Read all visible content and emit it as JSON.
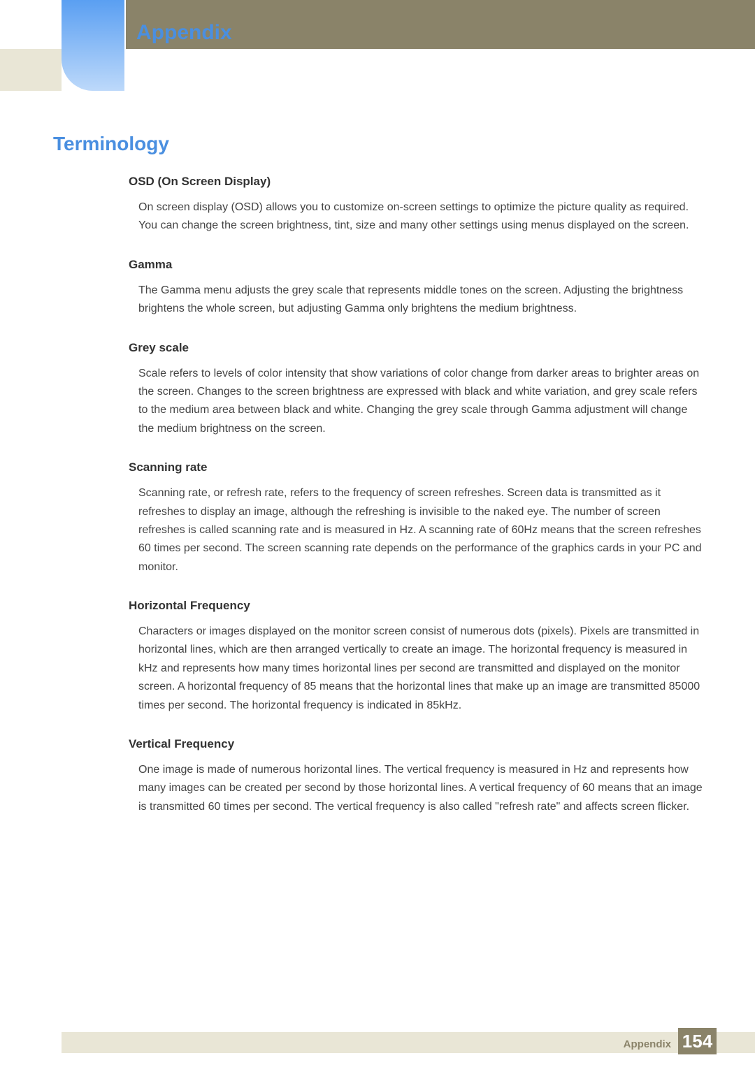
{
  "header": {
    "chapter": "Appendix",
    "section": "Terminology"
  },
  "terms": [
    {
      "title": "OSD (On Screen Display)",
      "body": "On screen display (OSD) allows you to customize on-screen settings to optimize the picture quality as required. You can change the screen brightness, tint, size and many other settings using menus displayed on the screen."
    },
    {
      "title": "Gamma",
      "body": "The Gamma menu adjusts the grey scale that represents middle tones on the screen. Adjusting the brightness brightens the whole screen, but adjusting Gamma only brightens the medium brightness."
    },
    {
      "title": "Grey scale",
      "body": "Scale refers to levels of color intensity that show variations of color change from darker areas to brighter areas on the screen. Changes to the screen brightness are expressed with black and white variation, and grey scale refers to the medium area between black and white. Changing the grey scale through Gamma adjustment will change the medium brightness on the screen."
    },
    {
      "title": "Scanning rate",
      "body": "Scanning rate, or refresh rate, refers to the frequency of screen refreshes. Screen data is transmitted as it refreshes to display an image, although the refreshing is invisible to the naked eye. The number of screen refreshes is called scanning rate and is measured in Hz. A scanning rate of 60Hz means that the screen refreshes 60 times per second. The screen scanning rate depends on the performance of the graphics cards in your PC and monitor."
    },
    {
      "title": "Horizontal Frequency",
      "body": "Characters or images displayed on the monitor screen consist of numerous dots (pixels). Pixels are transmitted in horizontal lines, which are then arranged vertically to create an image. The horizontal frequency is measured in kHz and represents how many times horizontal lines per second are transmitted and displayed on the monitor screen. A horizontal frequency of 85 means that the horizontal lines that make up an image are transmitted 85000 times per second. The horizontal frequency is indicated in 85kHz."
    },
    {
      "title": "Vertical Frequency",
      "body": "One image is made of numerous horizontal lines. The vertical frequency is measured in Hz and represents how many images can be created per second by those horizontal lines. A vertical frequency of 60 means that an image is transmitted 60 times per second. The vertical frequency is also called \"refresh rate\" and affects screen flicker."
    }
  ],
  "footer": {
    "label": "Appendix",
    "page": "154"
  }
}
